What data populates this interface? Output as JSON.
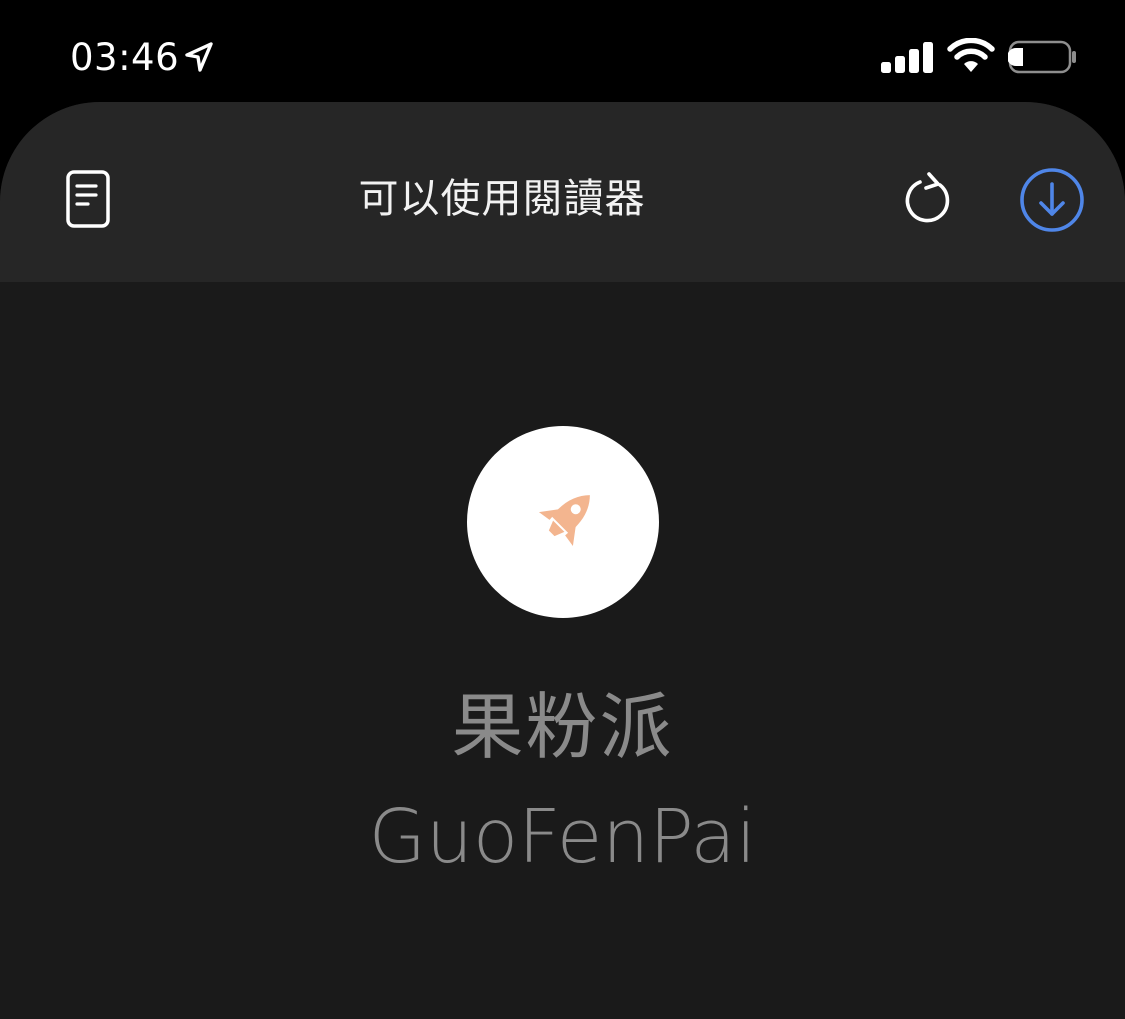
{
  "status_bar": {
    "time": "03:46",
    "location_icon": "location-arrow-icon",
    "signal_icon": "cellular-signal-icon",
    "wifi_icon": "wifi-icon",
    "battery_icon": "battery-low-icon"
  },
  "nav_bar": {
    "title": "可以使用閱讀器",
    "reader_icon": "reader-document-icon",
    "reload_icon": "reload-icon",
    "download_icon": "download-circle-icon"
  },
  "content": {
    "logo_icon": "rocket-icon",
    "site_name_cn": "果粉派",
    "site_name_en": "GuoFenPai"
  },
  "colors": {
    "background": "#1a1a1a",
    "nav_background": "#262626",
    "accent_blue": "#4f86e8",
    "rocket": "#f3b58f",
    "site_name": "#8a8a8a"
  }
}
